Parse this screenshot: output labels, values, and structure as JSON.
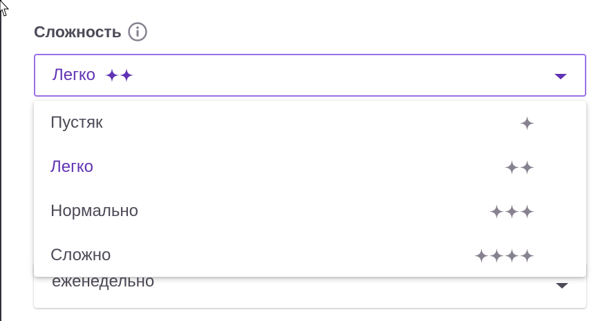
{
  "difficulty": {
    "label": "Сложность",
    "info_icon": "info-circle-icon",
    "selected": {
      "label": "Легко",
      "stars": 2,
      "color": "#6133b4"
    },
    "options": [
      {
        "label": "Пустяк",
        "stars": 1,
        "selected": false
      },
      {
        "label": "Легко",
        "stars": 2,
        "selected": true
      },
      {
        "label": "Нормально",
        "stars": 3,
        "selected": false
      },
      {
        "label": "Сложно",
        "stars": 4,
        "selected": false
      }
    ]
  },
  "repeat": {
    "value": "еженедельно"
  },
  "colors": {
    "accent": "#6133b4",
    "accent_border": "#9a70e6",
    "text": "#4e4a57",
    "star_muted": "#878190"
  }
}
